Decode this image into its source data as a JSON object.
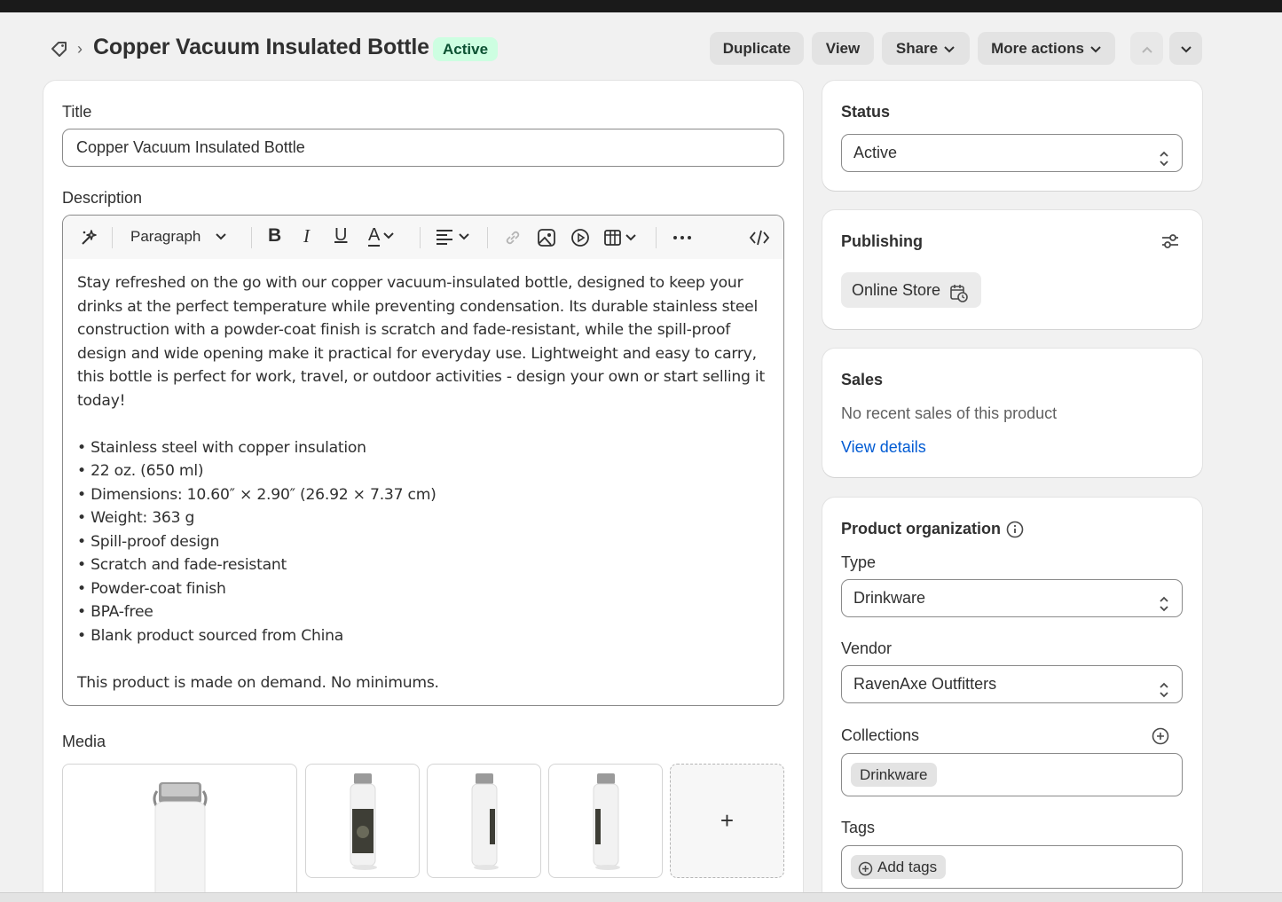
{
  "header": {
    "title": "Copper Vacuum Insulated Bottle",
    "status_badge": "Active",
    "buttons": {
      "duplicate": "Duplicate",
      "view": "View",
      "share": "Share",
      "more_actions": "More actions"
    }
  },
  "main": {
    "title_label": "Title",
    "title_value": "Copper Vacuum Insulated Bottle",
    "description_label": "Description",
    "toolbar": {
      "paragraph": "Paragraph"
    },
    "description": {
      "intro": "Stay refreshed on the go with our copper vacuum-insulated bottle, designed to keep your drinks at the perfect temperature while preventing condensation. Its durable stainless steel construction with a powder-coat finish is scratch and fade-resistant, while the spill-proof design and wide opening make it practical for everyday use. Lightweight and easy to carry, this bottle is perfect for work, travel, or outdoor activities - design your own or start selling it today!",
      "bullets": [
        "• Stainless steel with copper insulation",
        "• 22 oz. (650 ml)",
        "• Dimensions: 10.60″ × 2.90″ (26.92 × 7.37 cm)",
        "• Weight: 363 g",
        "• Spill-proof design",
        "• Scratch and fade-resistant",
        "• Powder-coat finish",
        "• BPA-free",
        "• Blank product sourced from China"
      ],
      "closing": "This product is made on demand. No minimums."
    },
    "media_label": "Media",
    "media_add": "+"
  },
  "sidebar": {
    "status": {
      "title": "Status",
      "value": "Active"
    },
    "publishing": {
      "title": "Publishing",
      "channel": "Online Store"
    },
    "sales": {
      "title": "Sales",
      "text": "No recent sales of this product",
      "link": "View details"
    },
    "organization": {
      "title": "Product organization",
      "type_label": "Type",
      "type_value": "Drinkware",
      "vendor_label": "Vendor",
      "vendor_value": "RavenAxe Outfitters",
      "collections_label": "Collections",
      "collections": [
        "Drinkware"
      ],
      "tags_label": "Tags",
      "add_tags": "Add tags"
    }
  }
}
